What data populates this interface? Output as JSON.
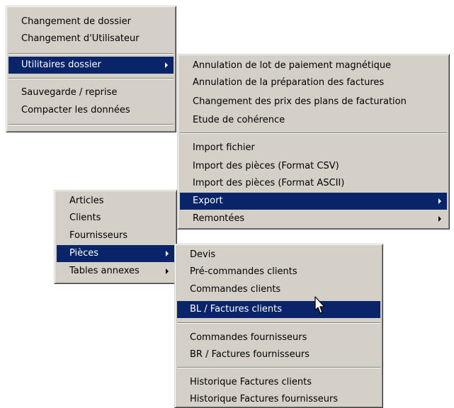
{
  "menu_file": {
    "items": [
      {
        "label": "Changement de dossier"
      },
      {
        "label": "Changement d'Utilisateur"
      },
      {
        "label": "Utilitaires dossier"
      },
      {
        "label": "Sauvegarde / reprise"
      },
      {
        "label": "Compacter les données"
      }
    ]
  },
  "menu_utilities": {
    "items": [
      {
        "label": "Annulation de lot de paiement magnétique"
      },
      {
        "label": "Annulation de la préparation des factures"
      },
      {
        "label": "Changement des prix des plans de facturation"
      },
      {
        "label": "Etude de cohérence"
      },
      {
        "label": "Import fichier"
      },
      {
        "label": "Import des pièces (Format CSV)"
      },
      {
        "label": "Import des pièces (Format ASCII)"
      },
      {
        "label": "Export"
      },
      {
        "label": "Remontées"
      }
    ]
  },
  "menu_export": {
    "items": [
      {
        "label": "Articles"
      },
      {
        "label": "Clients"
      },
      {
        "label": "Fournisseurs"
      },
      {
        "label": "Pièces"
      },
      {
        "label": "Tables annexes"
      }
    ]
  },
  "menu_pieces": {
    "items": [
      {
        "label": "Devis"
      },
      {
        "label": "Pré-commandes clients"
      },
      {
        "label": "Commandes clients"
      },
      {
        "label": "BL / Factures clients"
      },
      {
        "label": "Commandes fournisseurs"
      },
      {
        "label": "BR / Factures fournisseurs"
      },
      {
        "label": "Historique Factures clients"
      },
      {
        "label": "Historique Factures fournisseurs"
      }
    ]
  },
  "colors": {
    "menu_background": "#d4d0c8",
    "selection": "#0a246a",
    "selection_text": "#ffffff"
  }
}
